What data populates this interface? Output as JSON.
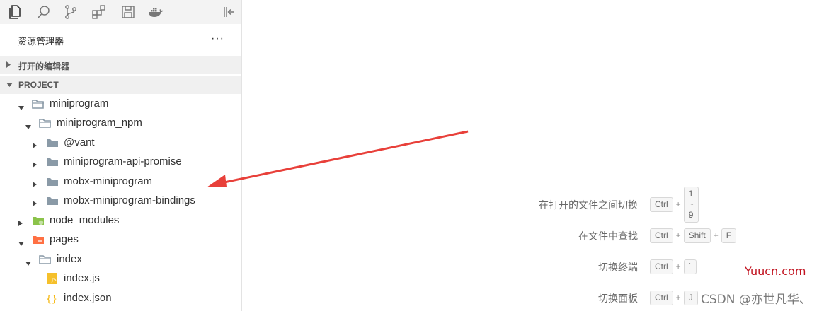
{
  "activity_bar": {
    "icons": [
      "files-icon",
      "search-icon",
      "source-control-icon",
      "extensions-icon",
      "save-icon",
      "docker-icon",
      "collapse-sidebar-icon"
    ]
  },
  "explorer": {
    "title": "资源管理器",
    "more": "···",
    "open_editors_label": "打开的编辑器",
    "project_label": "PROJECT"
  },
  "tree": [
    {
      "name": "miniprogram",
      "depth": 0,
      "expanded": true,
      "kind": "folder-open"
    },
    {
      "name": "miniprogram_npm",
      "depth": 1,
      "expanded": true,
      "kind": "folder-open"
    },
    {
      "name": "@vant",
      "depth": 2,
      "expanded": false,
      "kind": "folder"
    },
    {
      "name": "miniprogram-api-promise",
      "depth": 2,
      "expanded": false,
      "kind": "folder"
    },
    {
      "name": "mobx-miniprogram",
      "depth": 2,
      "expanded": false,
      "kind": "folder"
    },
    {
      "name": "mobx-miniprogram-bindings",
      "depth": 2,
      "expanded": false,
      "kind": "folder"
    },
    {
      "name": "node_modules",
      "depth": 0,
      "expanded": false,
      "kind": "folder-node"
    },
    {
      "name": "pages",
      "depth": 0,
      "expanded": true,
      "kind": "folder-pages"
    },
    {
      "name": "index",
      "depth": 1,
      "expanded": true,
      "kind": "folder-open"
    },
    {
      "name": "index.js",
      "depth": 2,
      "expanded": null,
      "kind": "file-js"
    },
    {
      "name": "index.json",
      "depth": 2,
      "expanded": null,
      "kind": "file-json"
    }
  ],
  "shortcuts": [
    {
      "label": "在打开的文件之间切换",
      "keys": [
        "Ctrl",
        "1 ~ 9"
      ]
    },
    {
      "label": "在文件中查找",
      "keys": [
        "Ctrl",
        "Shift",
        "F"
      ]
    },
    {
      "label": "切换终端",
      "keys": [
        "Ctrl",
        "`"
      ]
    },
    {
      "label": "切换面板",
      "keys": [
        "Ctrl",
        "J"
      ]
    }
  ],
  "watermarks": {
    "site": "Yuucn.com",
    "csdn": "CSDN @亦世凡华、"
  },
  "colors": {
    "folder": "#8a9aa7",
    "node_folder": "#8bc34a",
    "pages_folder": "#ff7043",
    "js_file": "#f5c02b",
    "json_file": "#f5b300",
    "arrow": "#e8403a",
    "site_watermark": "#c1121f"
  }
}
